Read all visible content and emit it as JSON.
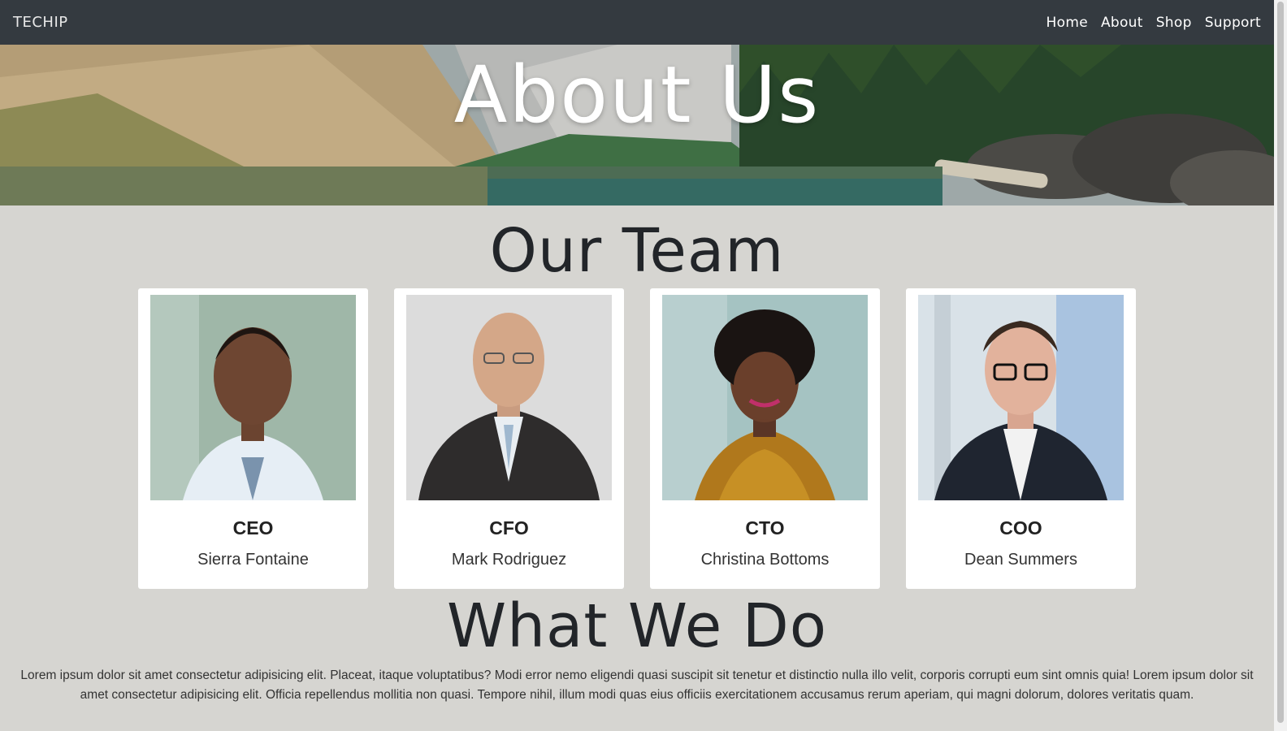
{
  "navbar": {
    "brand": "TECHIP",
    "links": [
      "Home",
      "About",
      "Shop",
      "Support"
    ],
    "background": "#343a40"
  },
  "hero": {
    "title": "About Us"
  },
  "team_section": {
    "title": "Our Team",
    "members": [
      {
        "role": "CEO",
        "name": "Sierra Fontaine",
        "photo_bg": "#9fb7a8"
      },
      {
        "role": "CFO",
        "name": "Mark Rodriguez",
        "photo_bg": "#dcdcdc"
      },
      {
        "role": "CTO",
        "name": "Christina Bottoms",
        "photo_bg": "#a5c3c2"
      },
      {
        "role": "COO",
        "name": "Dean Summers",
        "photo_bg": "#d9e2e8"
      }
    ]
  },
  "what_section": {
    "title": "What We Do",
    "paragraph": "Lorem ipsum dolor sit amet consectetur adipisicing elit. Placeat, itaque voluptatibus? Modi error nemo eligendi quasi suscipit sit tenetur et distinctio nulla illo velit, corporis corrupti eum sint omnis quia! Lorem ipsum dolor sit amet consectetur adipisicing elit. Officia repellendus mollitia non quasi. Tempore nihil, illum modi quas eius officiis exercitationem accusamus rerum aperiam, qui magni dolorum, dolores veritatis quam."
  },
  "colors": {
    "page_background": "#d6d5d1",
    "card_background": "#ffffff",
    "heading_color": "#222529"
  }
}
